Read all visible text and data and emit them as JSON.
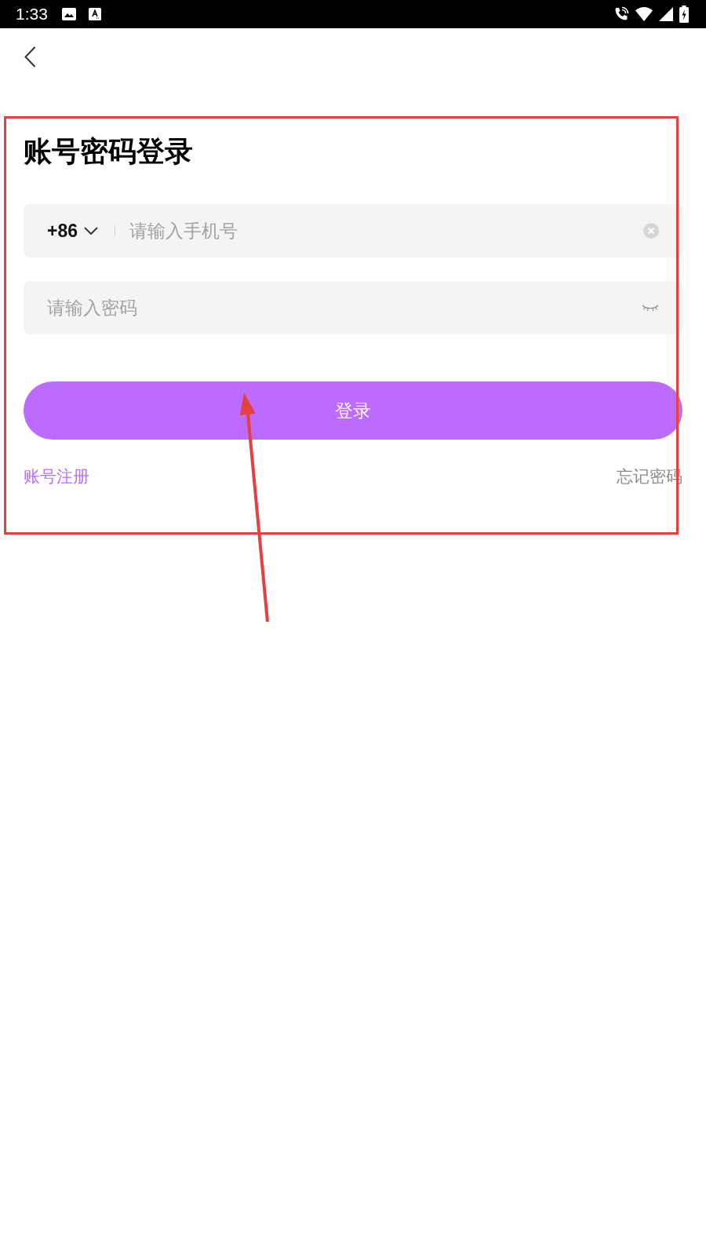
{
  "status_bar": {
    "time": "1:33"
  },
  "title": "账号密码登录",
  "phone_field": {
    "country_code": "+86",
    "placeholder": "请输入手机号"
  },
  "password_field": {
    "placeholder": "请输入密码"
  },
  "login_button": {
    "label": "登录"
  },
  "links": {
    "register": "账号注册",
    "forgot_password": "忘记密码"
  },
  "annotations": {
    "highlight_frame": true,
    "arrow": true
  }
}
